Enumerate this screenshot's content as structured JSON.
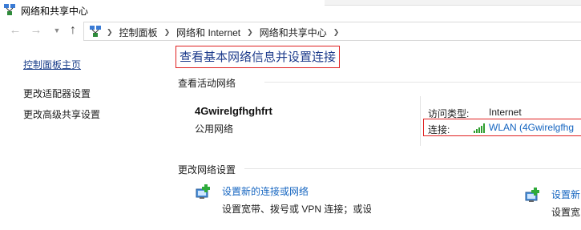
{
  "window": {
    "title": "网络和共享中心"
  },
  "breadcrumb": [
    "控制面板",
    "网络和 Internet",
    "网络和共享中心"
  ],
  "sidebar": {
    "home": "控制面板主页",
    "items": [
      "更改适配器设置",
      "更改高级共享设置"
    ]
  },
  "main": {
    "title": "查看基本网络信息并设置连接",
    "active_section": "查看活动网络",
    "network": {
      "name": "4Gwirelgfhghfrt",
      "type": "公用网络",
      "access_label": "访问类型:",
      "access_value": "Internet",
      "connection_label": "连接:",
      "connection_value": "WLAN (4Gwirelgfhg"
    },
    "change_section": "更改网络设置",
    "tasks": [
      {
        "title": "设置新的连接或网络",
        "desc": "设置宽带、拨号或 VPN 连接；或设"
      },
      {
        "title": "设置新",
        "desc": "设置宽"
      }
    ]
  },
  "colors": {
    "link": "#1565c0",
    "title": "#1e3c8c",
    "highlight": "#e02020"
  }
}
